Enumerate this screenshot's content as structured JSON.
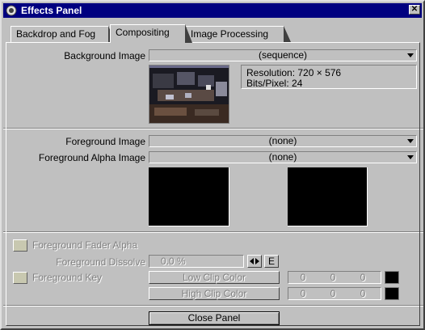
{
  "window": {
    "title": "Effects Panel",
    "close_symbol": "✕"
  },
  "tabs": [
    {
      "label": "Backdrop and Fog",
      "active": false
    },
    {
      "label": "Compositing",
      "active": true
    },
    {
      "label": "Image Processing",
      "active": false
    }
  ],
  "background": {
    "label": "Background Image",
    "selected": "(sequence)",
    "resolution": "Resolution: 720 × 576",
    "bits": "Bits/Pixel: 24"
  },
  "foreground": {
    "label": "Foreground Image",
    "selected": "(none)",
    "alpha_label": "Foreground Alpha Image",
    "alpha_selected": "(none)"
  },
  "options": {
    "fader_alpha_label": "Foreground Fader Alpha",
    "dissolve_label": "Foreground Dissolve",
    "dissolve_value": "0.0 %",
    "envelope_button": "E",
    "key_label": "Foreground Key",
    "low_clip_label": "Low Clip Color",
    "low_clip_values": [
      "0",
      "0",
      "0"
    ],
    "high_clip_label": "High Clip Color",
    "high_clip_values": [
      "0",
      "0",
      "0"
    ]
  },
  "footer": {
    "close_button": "Close Panel"
  },
  "colors": {
    "titlebar": "#000080",
    "face": "#c0c0c0"
  }
}
